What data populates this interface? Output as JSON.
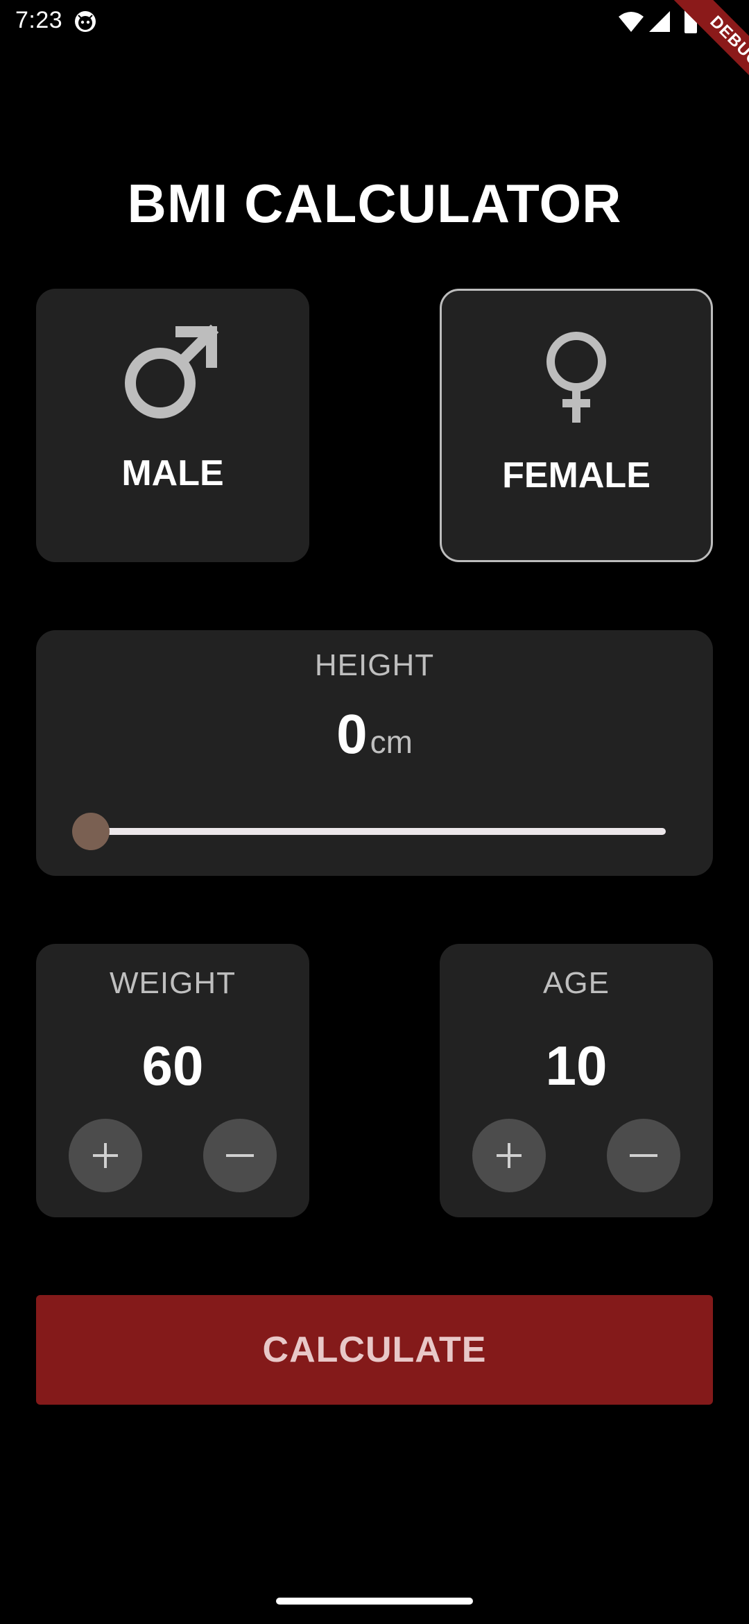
{
  "status_bar": {
    "time": "7:23",
    "app_icon": "android-face-icon",
    "wifi_icon": "wifi-icon",
    "signal_icon": "cell-signal-icon",
    "battery_icon": "battery-icon"
  },
  "debug_banner": {
    "label": "DEBUG"
  },
  "title": "BMI CALCULATOR",
  "gender": {
    "male": {
      "label": "MALE",
      "icon": "male-symbol-icon",
      "selected": false
    },
    "female": {
      "label": "FEMALE",
      "icon": "female-symbol-icon",
      "selected": true
    }
  },
  "height": {
    "label": "HEIGHT",
    "value": "0",
    "unit": "cm",
    "slider_fraction": 0.0
  },
  "weight": {
    "label": "WEIGHT",
    "value": "60",
    "plus_icon": "plus-icon",
    "minus_icon": "minus-icon"
  },
  "age": {
    "label": "AGE",
    "value": "10",
    "plus_icon": "plus-icon",
    "minus_icon": "minus-icon"
  },
  "calculate_button": {
    "label": "CALCULATE"
  },
  "colors": {
    "background": "#000000",
    "card": "#222222",
    "accent_button": "#841a1a",
    "slider_thumb": "#7a6052",
    "slider_track": "#ece7ea",
    "round_button": "#4c4c4c"
  }
}
